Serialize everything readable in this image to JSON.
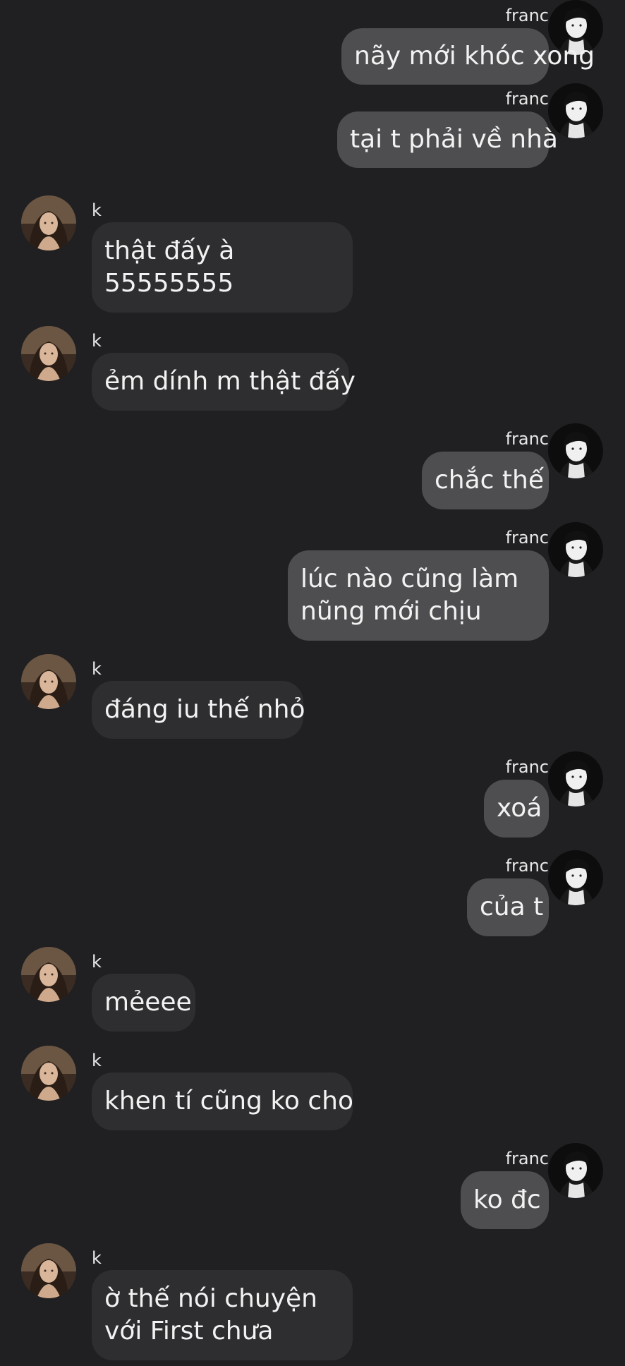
{
  "chat": {
    "messages": [
      {
        "direction": "out",
        "sender": "franc",
        "lines": [
          "nãy mới khóc xong"
        ]
      },
      {
        "direction": "out",
        "sender": "franc",
        "lines": [
          "tại t phải về nhà"
        ]
      },
      {
        "direction": "in",
        "sender": "k",
        "lines": [
          "thật đấy à",
          "55555555"
        ]
      },
      {
        "direction": "in",
        "sender": "k",
        "lines": [
          "ẻm dính m thật đấy"
        ]
      },
      {
        "direction": "out",
        "sender": "franc",
        "lines": [
          "chắc thế"
        ]
      },
      {
        "direction": "out",
        "sender": "franc",
        "lines": [
          "lúc nào cũng làm",
          "nũng mới chịu"
        ]
      },
      {
        "direction": "in",
        "sender": "k",
        "lines": [
          "đáng iu thế nhỏ"
        ]
      },
      {
        "direction": "out",
        "sender": "franc",
        "lines": [
          "xoá"
        ]
      },
      {
        "direction": "out",
        "sender": "franc",
        "lines": [
          "của t"
        ]
      },
      {
        "direction": "in",
        "sender": "k",
        "lines": [
          "mẻeee"
        ]
      },
      {
        "direction": "in",
        "sender": "k",
        "lines": [
          "khen tí cũng ko cho"
        ]
      },
      {
        "direction": "out",
        "sender": "franc",
        "lines": [
          "ko đc"
        ]
      },
      {
        "direction": "in",
        "sender": "k",
        "lines": [
          "ờ thế nói chuyện",
          "với First chưa"
        ]
      }
    ]
  },
  "colors": {
    "background": "#202022",
    "outgoing_bubble": "#4e4e50",
    "incoming_bubble": "#2e2e30",
    "text": "#f2f2f2"
  },
  "icons": {
    "outgoing_avatar": "avatar-franc-icon",
    "incoming_avatar": "avatar-k-icon"
  }
}
